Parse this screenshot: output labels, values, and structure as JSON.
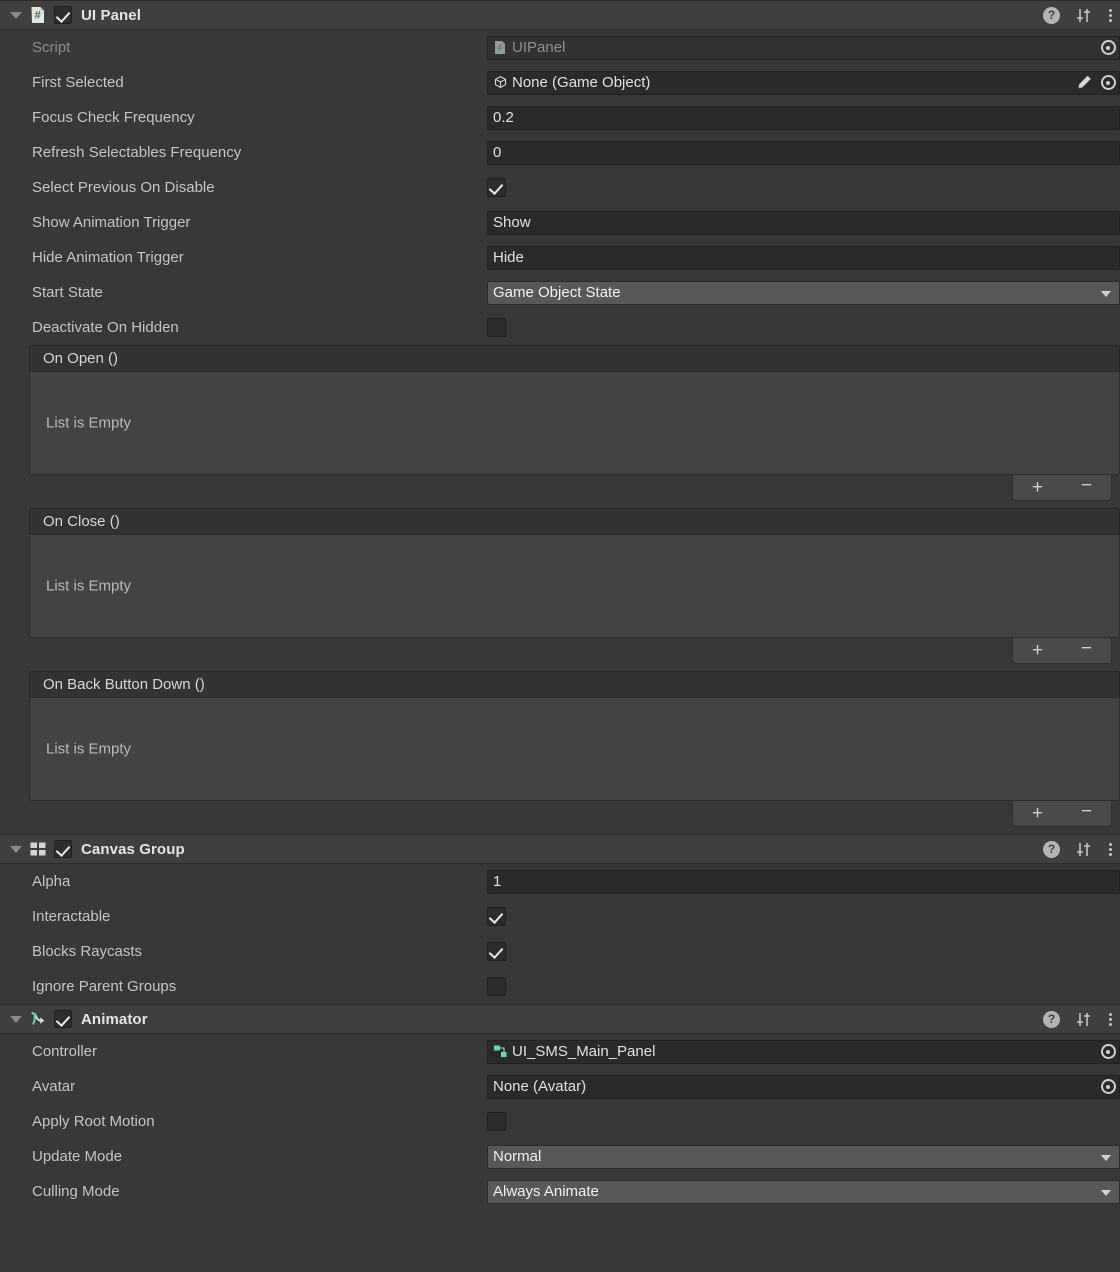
{
  "components": [
    {
      "id": "ui-panel",
      "title": "UI Panel",
      "icon": "script-icon",
      "enabled": true,
      "expanded": true,
      "tools": {
        "help": "?",
        "preset": "preset-icon",
        "menu": "kebab-icon"
      },
      "rows": [
        {
          "label": "Script",
          "type": "object",
          "value": "UIPanel",
          "icon": "script-asset-icon",
          "readonly": true,
          "picker": true
        },
        {
          "label": "First Selected",
          "type": "object",
          "value": "None (Game Object)",
          "icon": "gameobject-icon",
          "readonly": false,
          "picker": true,
          "pencil": true
        },
        {
          "label": "Focus Check Frequency",
          "type": "text",
          "value": "0.2"
        },
        {
          "label": "Refresh Selectables Frequency",
          "type": "text",
          "value": "0"
        },
        {
          "label": "Select Previous On Disable",
          "type": "checkbox",
          "checked": true
        },
        {
          "label": "Show Animation Trigger",
          "type": "text",
          "value": "Show"
        },
        {
          "label": "Hide Animation Trigger",
          "type": "text",
          "value": "Hide"
        },
        {
          "label": "Start State",
          "type": "popup",
          "value": "Game Object State"
        },
        {
          "label": "Deactivate On Hidden",
          "type": "checkbox",
          "checked": false
        }
      ],
      "events": [
        {
          "title": "On Open ()",
          "empty_text": "List is Empty",
          "add_label": "+",
          "remove_label": "−"
        },
        {
          "title": "On Close ()",
          "empty_text": "List is Empty",
          "add_label": "+",
          "remove_label": "−"
        },
        {
          "title": "On Back Button Down ()",
          "empty_text": "List is Empty",
          "add_label": "+",
          "remove_label": "−"
        }
      ]
    },
    {
      "id": "canvas-group",
      "title": "Canvas Group",
      "icon": "canvasgroup-icon",
      "enabled": true,
      "expanded": true,
      "tools": {
        "help": "?",
        "preset": "preset-icon",
        "menu": "kebab-icon"
      },
      "rows": [
        {
          "label": "Alpha",
          "type": "text",
          "value": "1"
        },
        {
          "label": "Interactable",
          "type": "checkbox",
          "checked": true
        },
        {
          "label": "Blocks Raycasts",
          "type": "checkbox",
          "checked": true
        },
        {
          "label": "Ignore Parent Groups",
          "type": "checkbox",
          "checked": false
        }
      ],
      "events": []
    },
    {
      "id": "animator",
      "title": "Animator",
      "icon": "animator-icon",
      "enabled": true,
      "expanded": true,
      "tools": {
        "help": "?",
        "preset": "preset-icon",
        "menu": "kebab-icon"
      },
      "rows": [
        {
          "label": "Controller",
          "type": "object",
          "value": "UI_SMS_Main_Panel",
          "icon": "animator-controller-icon",
          "picker": true
        },
        {
          "label": "Avatar",
          "type": "object",
          "value": "None (Avatar)",
          "picker": true
        },
        {
          "label": "Apply Root Motion",
          "type": "checkbox",
          "checked": false
        },
        {
          "label": "Update Mode",
          "type": "popup",
          "value": "Normal"
        },
        {
          "label": "Culling Mode",
          "type": "popup",
          "value": "Always Animate"
        }
      ],
      "events": []
    }
  ],
  "colors": {
    "background": "#383838",
    "header": "#3f3f3f",
    "field": "#2a2a2a",
    "popup": "#585858",
    "list_body": "#434343",
    "accent_green": "#4f9e5a",
    "accent_teal": "#64d6b4"
  }
}
